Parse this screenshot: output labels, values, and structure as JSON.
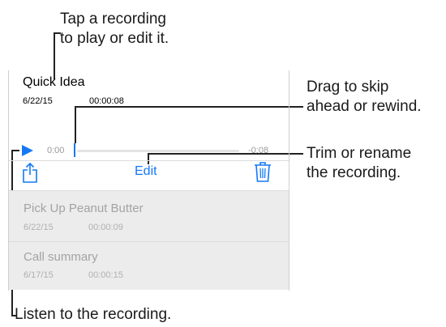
{
  "callouts": {
    "tap": [
      "Tap a recording",
      "to play or edit it."
    ],
    "drag": [
      "Drag to skip",
      "ahead or rewind."
    ],
    "trim": [
      "Trim or rename",
      "the recording."
    ],
    "listen": "Listen to the recording."
  },
  "selected_recording": {
    "title": "Quick Idea",
    "date": "6/22/15",
    "duration": "00:00:08",
    "elapsed": "0:00",
    "remaining": "-0:08",
    "progress": 0.0
  },
  "toolbar": {
    "share_icon": "share-icon",
    "edit_label": "Edit",
    "trash_icon": "trash-icon",
    "accent_color": "#1478f6"
  },
  "recordings": [
    {
      "title": "Pick Up Peanut Butter",
      "date": "6/22/15",
      "duration": "00:00:09"
    },
    {
      "title": "Call summary",
      "date": "6/17/15",
      "duration": "00:00:15"
    }
  ]
}
